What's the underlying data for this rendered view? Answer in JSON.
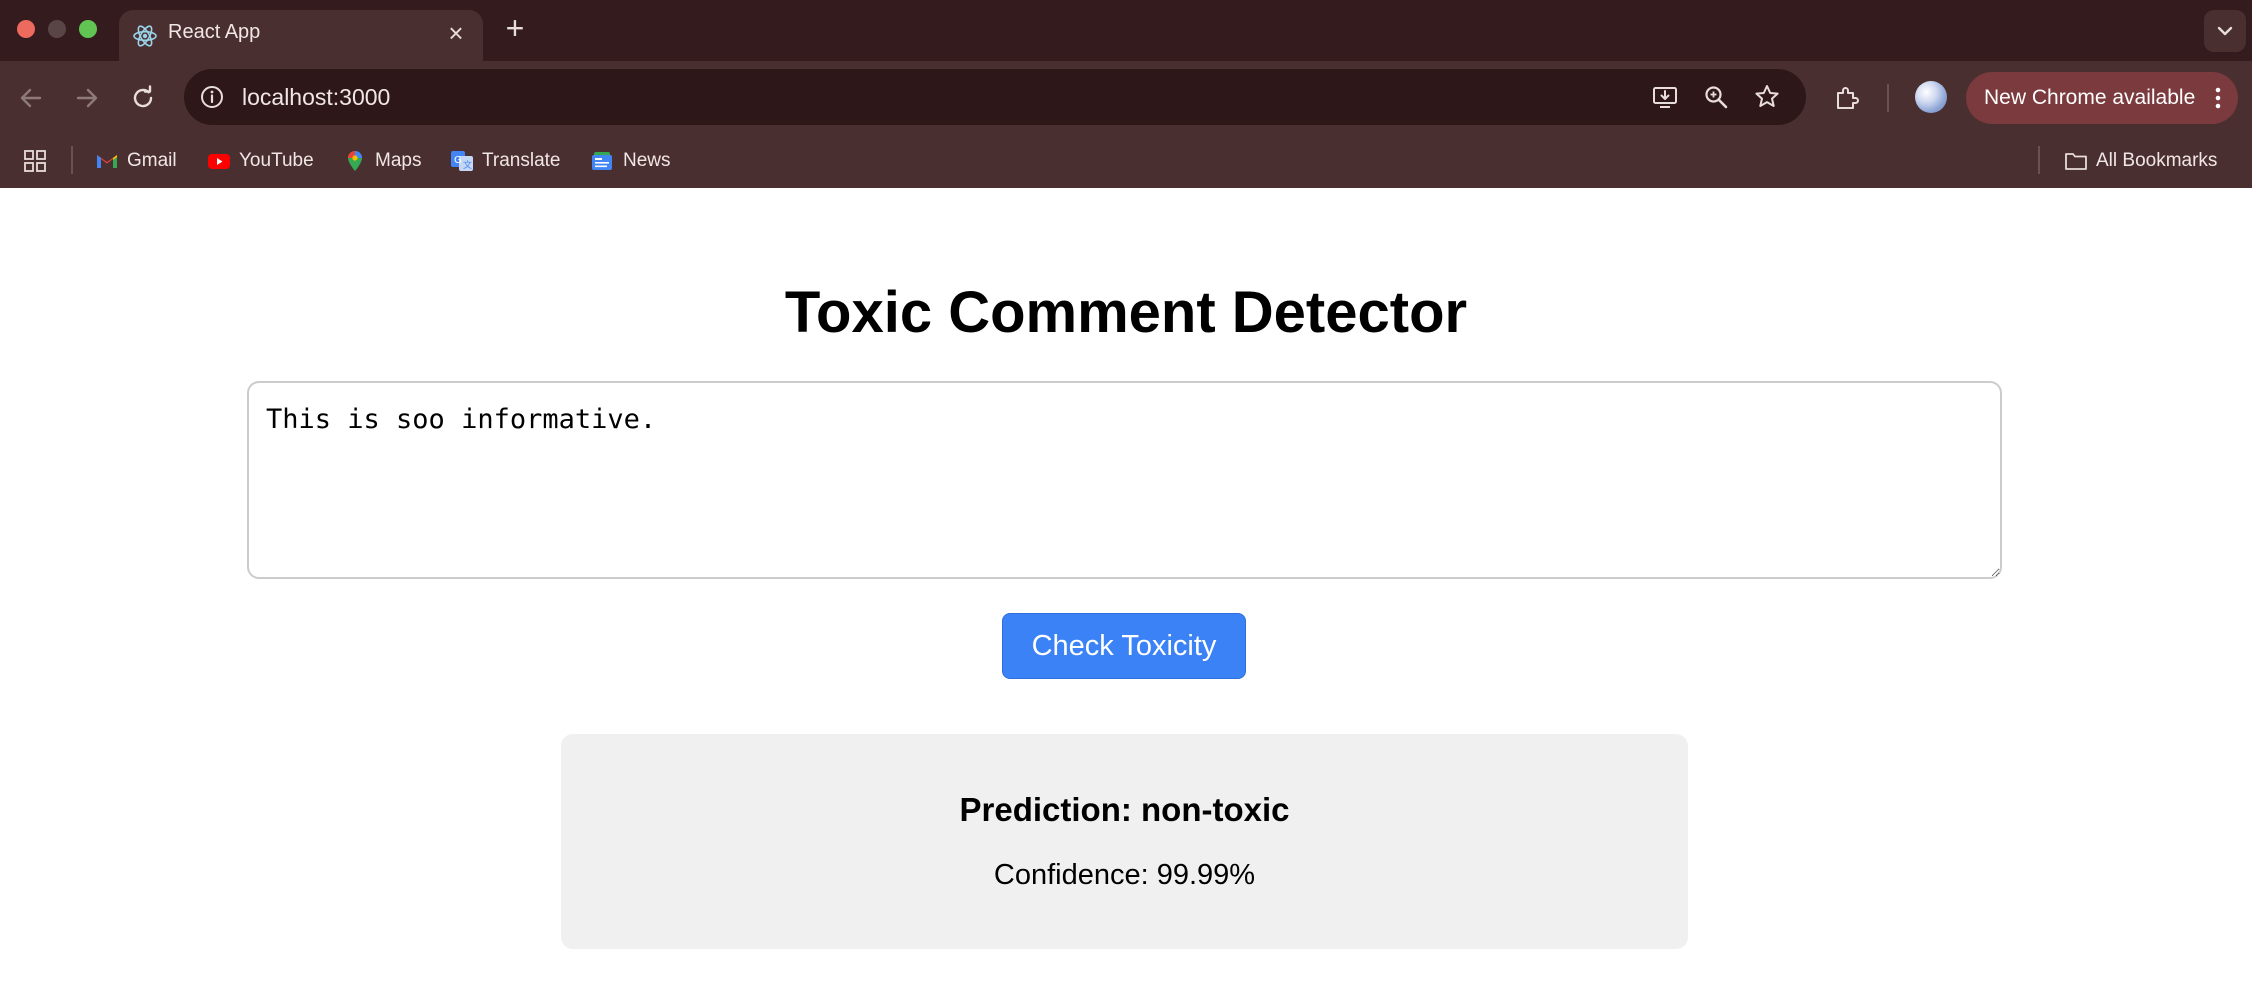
{
  "browser": {
    "tab": {
      "title": "React App",
      "favicon": "react-icon"
    },
    "url": "localhost:3000",
    "update_label": "New Chrome available",
    "colors": {
      "tabstrip": "#341b1d",
      "toolbar": "#4a2f31",
      "omnibox": "#2e1719",
      "update_pill": "#7b3a3d"
    },
    "bookmarks": [
      {
        "label": "Gmail",
        "icon": "gmail-icon"
      },
      {
        "label": "YouTube",
        "icon": "youtube-icon"
      },
      {
        "label": "Maps",
        "icon": "maps-icon"
      },
      {
        "label": "Translate",
        "icon": "translate-icon"
      },
      {
        "label": "News",
        "icon": "news-icon"
      }
    ],
    "all_bookmarks_label": "All Bookmarks"
  },
  "app": {
    "title": "Toxic Comment Detector",
    "comment": {
      "value": "This is soo informative.",
      "placeholder": ""
    },
    "check_button_label": "Check Toxicity",
    "result": {
      "prediction": "Prediction: non-toxic",
      "confidence": "Confidence: 99.99%"
    },
    "colors": {
      "button": "#3b82f6",
      "result_card": "#f0f0f0"
    }
  }
}
